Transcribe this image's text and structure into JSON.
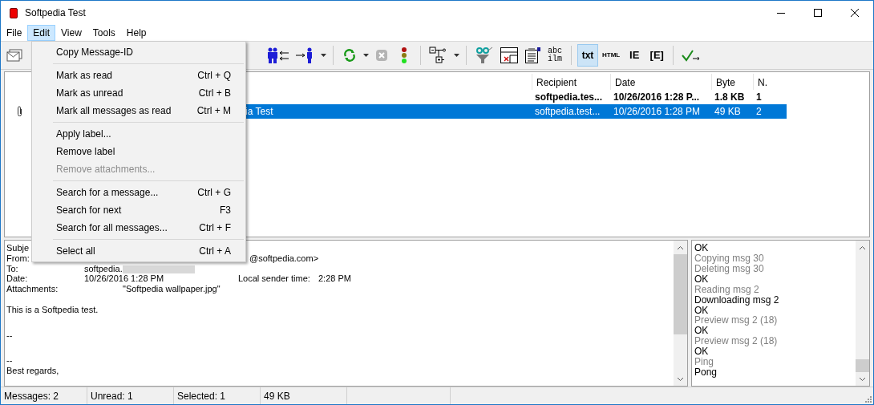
{
  "window": {
    "title": "Softpedia Test"
  },
  "menubar": [
    {
      "label": "File",
      "selected": false
    },
    {
      "label": "Edit",
      "selected": true
    },
    {
      "label": "View",
      "selected": false
    },
    {
      "label": "Tools",
      "selected": false
    },
    {
      "label": "Help",
      "selected": false
    }
  ],
  "edit_menu": [
    {
      "kind": "item",
      "label": "Copy Message-ID",
      "disabled": false
    },
    {
      "kind": "separator"
    },
    {
      "kind": "item",
      "label": "Mark as read",
      "shortcut": "Ctrl + Q",
      "disabled": false
    },
    {
      "kind": "item",
      "label": "Mark as unread",
      "shortcut": "Ctrl + B",
      "disabled": false
    },
    {
      "kind": "item",
      "label": "Mark all messages as read",
      "shortcut": "Ctrl + M",
      "disabled": false
    },
    {
      "kind": "separator"
    },
    {
      "kind": "item",
      "label": "Apply label...",
      "disabled": false
    },
    {
      "kind": "item",
      "label": "Remove label",
      "disabled": false
    },
    {
      "kind": "item",
      "label": "Remove attachments...",
      "disabled": true
    },
    {
      "kind": "separator"
    },
    {
      "kind": "item",
      "label": "Search for a message...",
      "shortcut": "Ctrl + G",
      "disabled": false
    },
    {
      "kind": "item",
      "label": "Search for next",
      "shortcut": "F3",
      "disabled": false
    },
    {
      "kind": "item",
      "label": "Search for all messages...",
      "shortcut": "Ctrl + F",
      "disabled": false
    },
    {
      "kind": "separator"
    },
    {
      "kind": "item",
      "label": "Select all",
      "shortcut": "Ctrl + A",
      "disabled": false
    }
  ],
  "toolbar": {
    "abc_button": [
      "abc",
      "ilm"
    ],
    "view_buttons": [
      {
        "label": "txt",
        "selected": true
      },
      {
        "label": "HTML",
        "selected": false
      },
      {
        "label": "IE",
        "selected": false
      },
      {
        "label": "[E]",
        "selected": false
      }
    ]
  },
  "message_list": {
    "columns": [
      "Recipient",
      "Date",
      "Byte",
      "N."
    ],
    "rows": [
      {
        "attachment": false,
        "unread": true,
        "selected": false,
        "recipient": "softpedia.tes...",
        "date": "10/26/2016 1:28 P...",
        "size": "1.8 KB",
        "number": "1"
      },
      {
        "attachment": true,
        "unread": false,
        "selected": true,
        "subject": "ia Test",
        "recipient": "softpedia.test...",
        "date": "10/26/2016 1:28 PM",
        "size": "49 KB",
        "number": "2"
      }
    ]
  },
  "preview": {
    "subject_label": "Subje",
    "from_label": "From:",
    "from_value": "@softpedia.com>",
    "to_label": "To:",
    "to_value": "softpedia.",
    "date_label": "Date:",
    "date_value": "10/26/2016 1:28 PM",
    "local_time_label": "Local sender time:",
    "local_time_value": "2:28 PM",
    "attachments_label": "Attachments:",
    "attachments_value": "\"Softpedia wallpaper.jpg\"",
    "body": [
      [
        "This is a Softpedia test."
      ],
      [
        "--"
      ],
      [
        "--",
        "Best regards,"
      ]
    ]
  },
  "log": [
    {
      "text": "OK",
      "muted": false
    },
    {
      "text": "Copying msg 30",
      "muted": true
    },
    {
      "text": "Deleting msg 30",
      "muted": true
    },
    {
      "text": "OK",
      "muted": false
    },
    {
      "text": "Reading msg 2",
      "muted": true
    },
    {
      "text": "Downloading msg 2",
      "muted": false
    },
    {
      "text": "OK",
      "muted": false
    },
    {
      "text": "Preview msg 2 (18)",
      "muted": true
    },
    {
      "text": "OK",
      "muted": false
    },
    {
      "text": "Preview msg 2 (18)",
      "muted": true
    },
    {
      "text": "OK",
      "muted": false
    },
    {
      "text": "Ping",
      "muted": true
    },
    {
      "text": "Pong",
      "muted": false
    }
  ],
  "status_bar": [
    "Messages: 2",
    "Unread: 1",
    "Selected: 1",
    "49 KB"
  ]
}
